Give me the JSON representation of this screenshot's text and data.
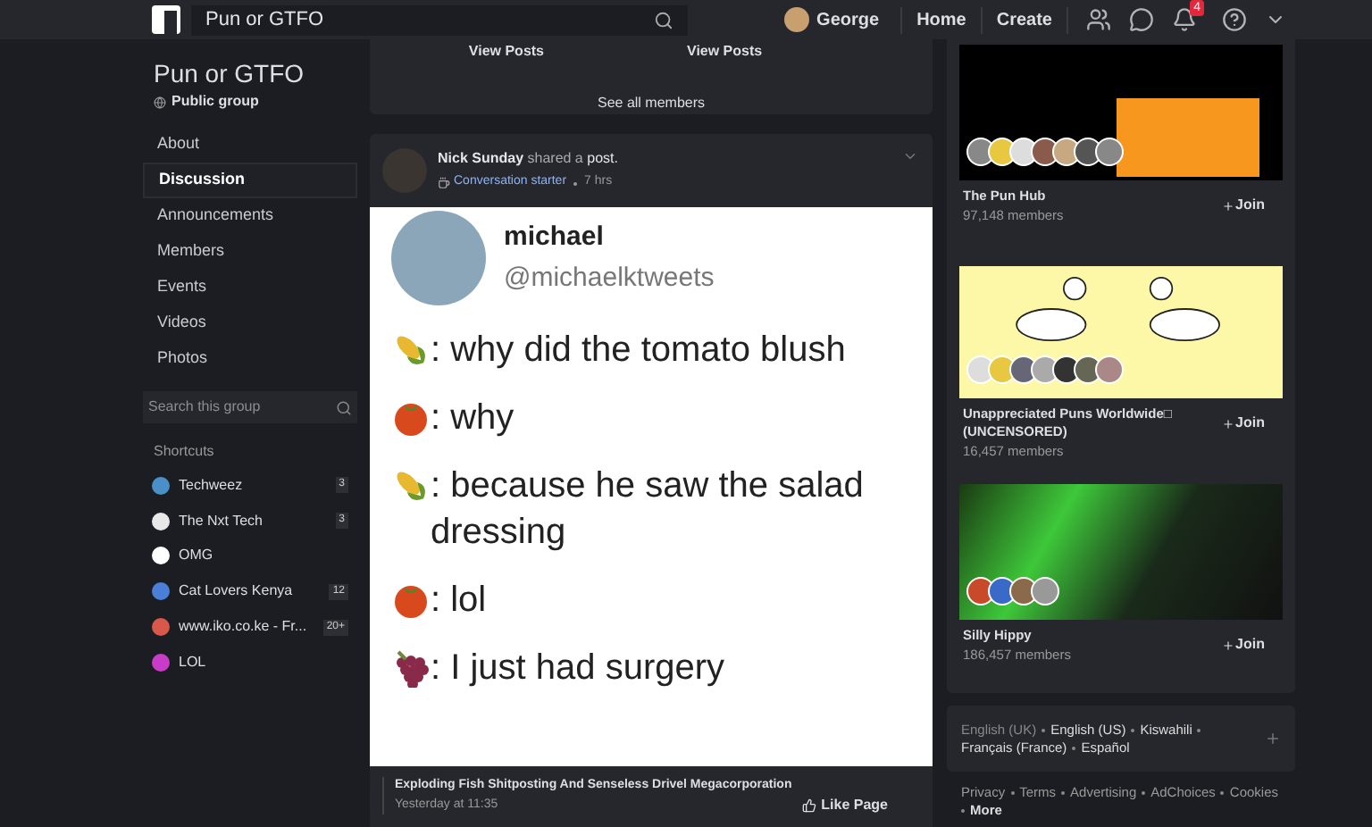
{
  "topbar": {
    "search_value": "Pun or GTFO",
    "user": "George",
    "links": [
      "Home",
      "Create"
    ],
    "notifications_badge": "4"
  },
  "group": {
    "name": "Pun or GTFO",
    "privacy": "Public group"
  },
  "nav": [
    {
      "label": "About",
      "selected": false
    },
    {
      "label": "Discussion",
      "selected": true
    },
    {
      "label": "Announcements",
      "selected": false
    },
    {
      "label": "Members",
      "selected": false
    },
    {
      "label": "Events",
      "selected": false
    },
    {
      "label": "Videos",
      "selected": false
    },
    {
      "label": "Photos",
      "selected": false
    }
  ],
  "group_search": {
    "placeholder": "Search this group"
  },
  "shortcuts": {
    "title": "Shortcuts",
    "items": [
      {
        "label": "Techweez",
        "count": "3",
        "color": "#4a90c8"
      },
      {
        "label": "The Nxt Tech",
        "count": "3",
        "color": "#e8e8e8"
      },
      {
        "label": "OMG",
        "color": "#ffffff"
      },
      {
        "label": "Cat Lovers Kenya",
        "count": "12",
        "color": "#4a7fd8"
      },
      {
        "label": "www.iko.co.ke - Fr...",
        "count": "20+",
        "color": "#d8584a"
      },
      {
        "label": "LOL",
        "color": "#c83cc8"
      }
    ]
  },
  "members_card": {
    "view_posts": [
      "View Posts",
      "View Posts"
    ],
    "see_all": "See all members"
  },
  "post": {
    "author": "Nick Sunday",
    "action": "shared a",
    "object": "post.",
    "badge": "Conversation starter",
    "time": "7 hrs",
    "tweet": {
      "name": "michael",
      "handle": "@michaelktweets",
      "lines": [
        {
          "kind": "corn",
          "text": ": why did the tomato blush"
        },
        {
          "kind": "tomato",
          "text": ": why"
        },
        {
          "kind": "corn",
          "text": ": because he saw the salad dressing"
        },
        {
          "kind": "tomato",
          "text": ": lol"
        },
        {
          "kind": "grapes",
          "text": ": I just had surgery"
        }
      ]
    },
    "source": "Exploding Fish Shitposting And Senseless Drivel Megacorporation",
    "source_time": "Yesterday at 11:35",
    "like_page": "Like Page"
  },
  "suggested_groups": [
    {
      "kind": "hub",
      "name": "The Pun Hub",
      "members": "97,148 members",
      "join": "Join"
    },
    {
      "kind": "geese",
      "name": "Unappreciated Puns Worldwide□ (UNCENSORED)",
      "members": "16,457 members",
      "join": "Join"
    },
    {
      "kind": "aurora",
      "name": "Silly Hippy",
      "members": "186,457 members",
      "join": "Join"
    }
  ],
  "languages": [
    {
      "label": "English (UK)",
      "selected": true
    },
    {
      "label": "English (US)",
      "selected": false
    },
    {
      "label": "Kiswahili",
      "selected": false
    },
    {
      "label": "Français (France)",
      "selected": false
    },
    {
      "label": "Español",
      "selected": false
    }
  ],
  "footer_links": [
    "Privacy",
    "Terms",
    "Advertising",
    "AdChoices",
    "Cookies",
    "More"
  ]
}
